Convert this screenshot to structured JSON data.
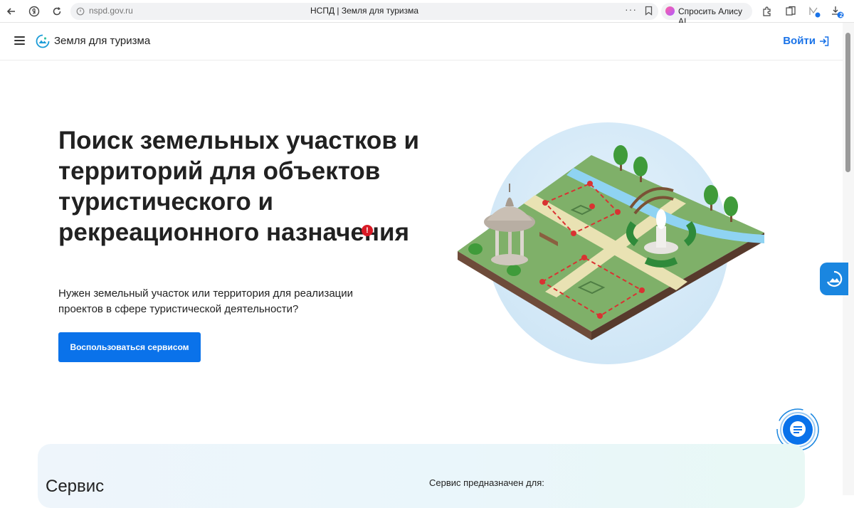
{
  "browser": {
    "url": "nspd.gov.ru",
    "page_title": "НСПД | Земля для туризма",
    "alice_label": "Спросить Алису AI",
    "download_badge": "2"
  },
  "header": {
    "brand": "Земля для туризма",
    "login_label": "Войти"
  },
  "hero": {
    "title": "Поиск земельных участков и территорий для объектов туристического и рекреационного назначения",
    "subtitle": "Нужен земельный участок или территория для реализации проектов в сфере туристической деятельности?",
    "cta_label": "Воспользоваться сервисом",
    "alert_mark": "!"
  },
  "service": {
    "title": "Сервис",
    "description": "Сервис предназначен для:"
  },
  "colors": {
    "accent": "#0a72ea",
    "alert": "#d81b26",
    "brand_blue": "#1a73e8"
  },
  "icons": [
    "back-icon",
    "yandex-icon",
    "reload-icon",
    "lock-icon",
    "more-icon",
    "bookmark-icon",
    "extensions-icon",
    "collections-icon",
    "profile-icon",
    "download-icon",
    "menu-icon",
    "logo-icon",
    "login-icon",
    "widget-icon",
    "chat-icon"
  ]
}
